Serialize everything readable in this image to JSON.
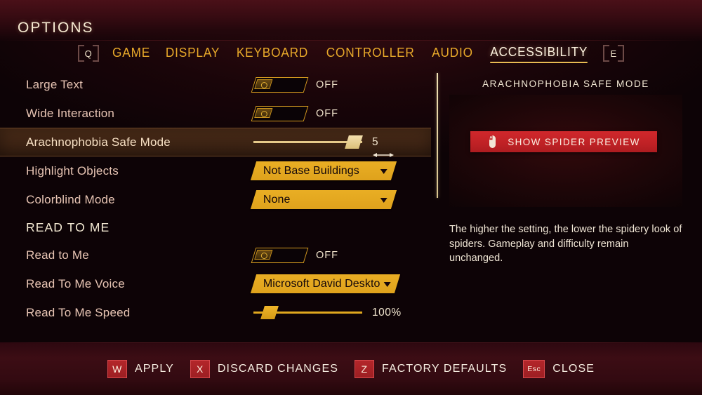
{
  "header": {
    "title": "OPTIONS"
  },
  "tabs": {
    "prev_key": "Q",
    "next_key": "E",
    "items": [
      {
        "label": "GAME",
        "active": false
      },
      {
        "label": "DISPLAY",
        "active": false
      },
      {
        "label": "KEYBOARD",
        "active": false
      },
      {
        "label": "CONTROLLER",
        "active": false
      },
      {
        "label": "AUDIO",
        "active": false
      },
      {
        "label": "ACCESSIBILITY",
        "active": true
      }
    ]
  },
  "settings": [
    {
      "type": "toggle",
      "label": "Large Text",
      "value": "OFF",
      "selected": false
    },
    {
      "type": "toggle",
      "label": "Wide Interaction",
      "value": "OFF",
      "selected": false
    },
    {
      "type": "slider",
      "label": "Arachnophobia Safe Mode",
      "value": "5",
      "percent": 92,
      "selected": true
    },
    {
      "type": "dropdown",
      "label": "Highlight Objects",
      "value": "Not Base Buildings",
      "selected": false
    },
    {
      "type": "dropdown",
      "label": "Colorblind Mode",
      "value": "None",
      "selected": false
    },
    {
      "type": "section",
      "label": "READ TO ME"
    },
    {
      "type": "toggle",
      "label": "Read to Me",
      "value": "OFF",
      "selected": false
    },
    {
      "type": "dropdown",
      "label": "Read To Me Voice",
      "value": "Microsoft David Deskto",
      "selected": false
    },
    {
      "type": "slider",
      "label": "Read To Me Speed",
      "value": "100%",
      "percent": 15,
      "selected": false
    }
  ],
  "preview": {
    "title": "ARACHNOPHOBIA SAFE MODE",
    "button_label": "SHOW SPIDER PREVIEW",
    "button_icon": "mouse-icon",
    "description": "The higher the setting, the lower the spidery look of spiders. Gameplay and difficulty remain unchanged."
  },
  "actions": [
    {
      "key": "W",
      "label": "APPLY",
      "small": false
    },
    {
      "key": "X",
      "label": "DISCARD CHANGES",
      "small": false
    },
    {
      "key": "Z",
      "label": "FACTORY DEFAULTS",
      "small": false
    },
    {
      "key": "Esc",
      "label": "CLOSE",
      "small": true
    }
  ],
  "colors": {
    "accent_gold": "#e8a92a",
    "active_tab": "#fdf3e0",
    "label": "#e8c5b4",
    "selected_row_bg": "#4a2c18",
    "danger_red": "#bf2125",
    "background": "#140407"
  }
}
